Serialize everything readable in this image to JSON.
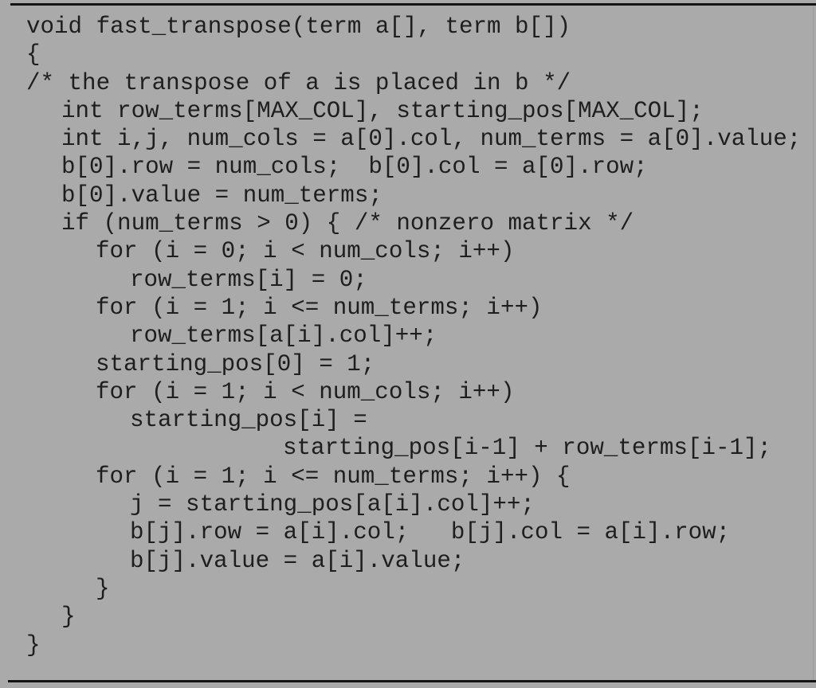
{
  "document": {
    "type": "code-listing",
    "language": "C",
    "lines": [
      {
        "indent": 0,
        "text": "void fast_transpose(term a[], term b[])"
      },
      {
        "indent": 0,
        "text": "{"
      },
      {
        "indent": 0,
        "text": "/* the transpose of a is placed in b */"
      },
      {
        "indent": 1,
        "text": "int row_terms[MAX_COL], starting_pos[MAX_COL];"
      },
      {
        "indent": 1,
        "text": "int i,j, num_cols = a[0].col, num_terms = a[0].value;"
      },
      {
        "indent": 1,
        "text": "b[0].row = num_cols;  b[0].col = a[0].row;"
      },
      {
        "indent": 1,
        "text": "b[0].value = num_terms;"
      },
      {
        "indent": 1,
        "text": "if (num_terms > 0) { /* nonzero matrix */"
      },
      {
        "indent": 2,
        "text": "for (i = 0; i < num_cols; i++)"
      },
      {
        "indent": 3,
        "text": "row_terms[i] = 0;"
      },
      {
        "indent": 2,
        "text": "for (i = 1; i <= num_terms; i++)"
      },
      {
        "indent": 3,
        "text": "row_terms[a[i].col]++;"
      },
      {
        "indent": 2,
        "text": "starting_pos[0] = 1;"
      },
      {
        "indent": 2,
        "text": "for (i = 1; i < num_cols; i++)"
      },
      {
        "indent": 3,
        "text": "starting_pos[i] ="
      },
      {
        "indent": "wrap",
        "text": "starting_pos[i-1] + row_terms[i-1];"
      },
      {
        "indent": 2,
        "text": "for (i = 1; i <= num_terms; i++) {"
      },
      {
        "indent": 3,
        "text": "j = starting_pos[a[i].col]++;"
      },
      {
        "indent": 3,
        "text": "b[j].row = a[i].col;   b[j].col = a[i].row;"
      },
      {
        "indent": 3,
        "text": "b[j].value = a[i].value;"
      },
      {
        "indent": 2,
        "text": "}"
      },
      {
        "indent": 1,
        "text": "}"
      },
      {
        "indent": 0,
        "text": "}"
      }
    ]
  }
}
